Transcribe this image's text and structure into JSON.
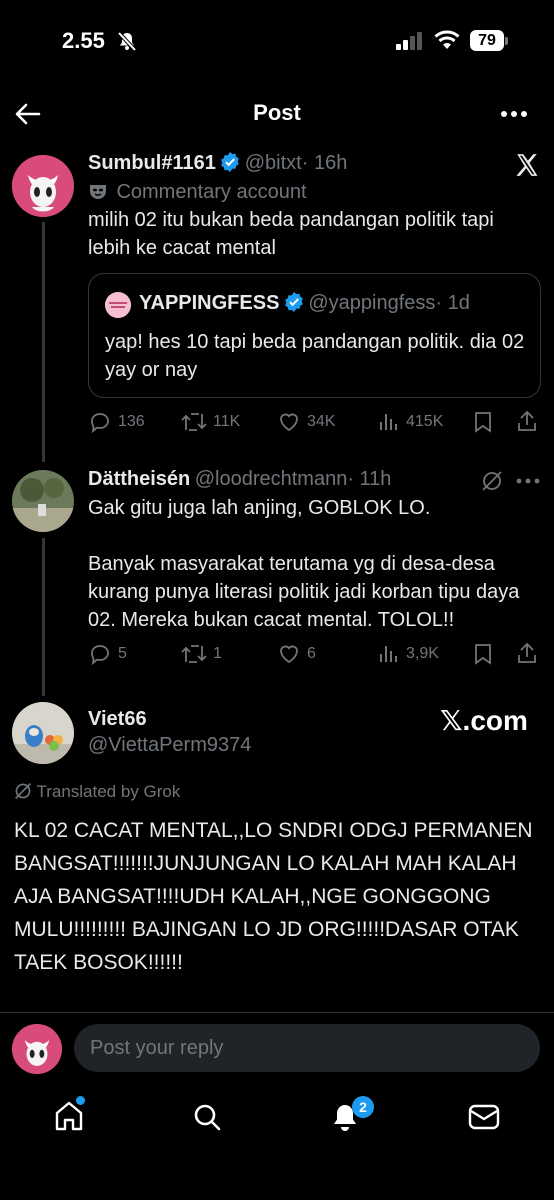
{
  "status": {
    "time": "2.55",
    "battery": "79"
  },
  "header": {
    "title": "Post"
  },
  "tweet1": {
    "name": "Sumbul#1161",
    "handle": "@bitxt",
    "time": "· 16h",
    "label": "Commentary account",
    "text": "milih 02 itu bukan beda pandangan politik tapi lebih ke cacat mental",
    "quote": {
      "name": "YAPPINGFESS",
      "handle": "@yappingfess",
      "time": "· 1d",
      "text": "yap! hes 10 tapi beda pandangan politik. dia 02 yay or nay"
    },
    "actions": {
      "replies": "136",
      "retweets": "11K",
      "likes": "34K",
      "views": "415K"
    }
  },
  "tweet2": {
    "name": "Dättheisén",
    "handle": "@loodrechtmann",
    "time": "· 11h",
    "text1": "Gak gitu juga lah anjing, GOBLOK LO.",
    "text2": "Banyak masyarakat terutama yg di desa-desa kurang punya literasi politik jadi korban tipu daya 02. Mereka bukan cacat mental. TOLOL!!",
    "actions": {
      "replies": "5",
      "retweets": "1",
      "likes": "6",
      "views": "3,9K"
    }
  },
  "card": {
    "name": "Viet66",
    "handle": "@ViettaPerm9374",
    "brand": "𝕏.com",
    "translated": "Translated by Grok",
    "text": "KL 02 CACAT MENTAL,,LO SNDRI ODGJ PERMANEN BANGSAT!!!!!!!JUNJUNGAN LO KALAH MAH KALAH AJA BANGSAT!!!!UDH KALAH,,NGE GONGGONG MULU!!!!!!!!! BAJINGAN LO JD ORG!!!!!DASAR OTAK TAEK BOSOK!!!!!!"
  },
  "reply": {
    "placeholder": "Post your reply"
  },
  "nav": {
    "notifications_count": "2"
  },
  "colors": {
    "accent": "#1d9bf0",
    "background": "#000000",
    "muted": "#71767b"
  }
}
